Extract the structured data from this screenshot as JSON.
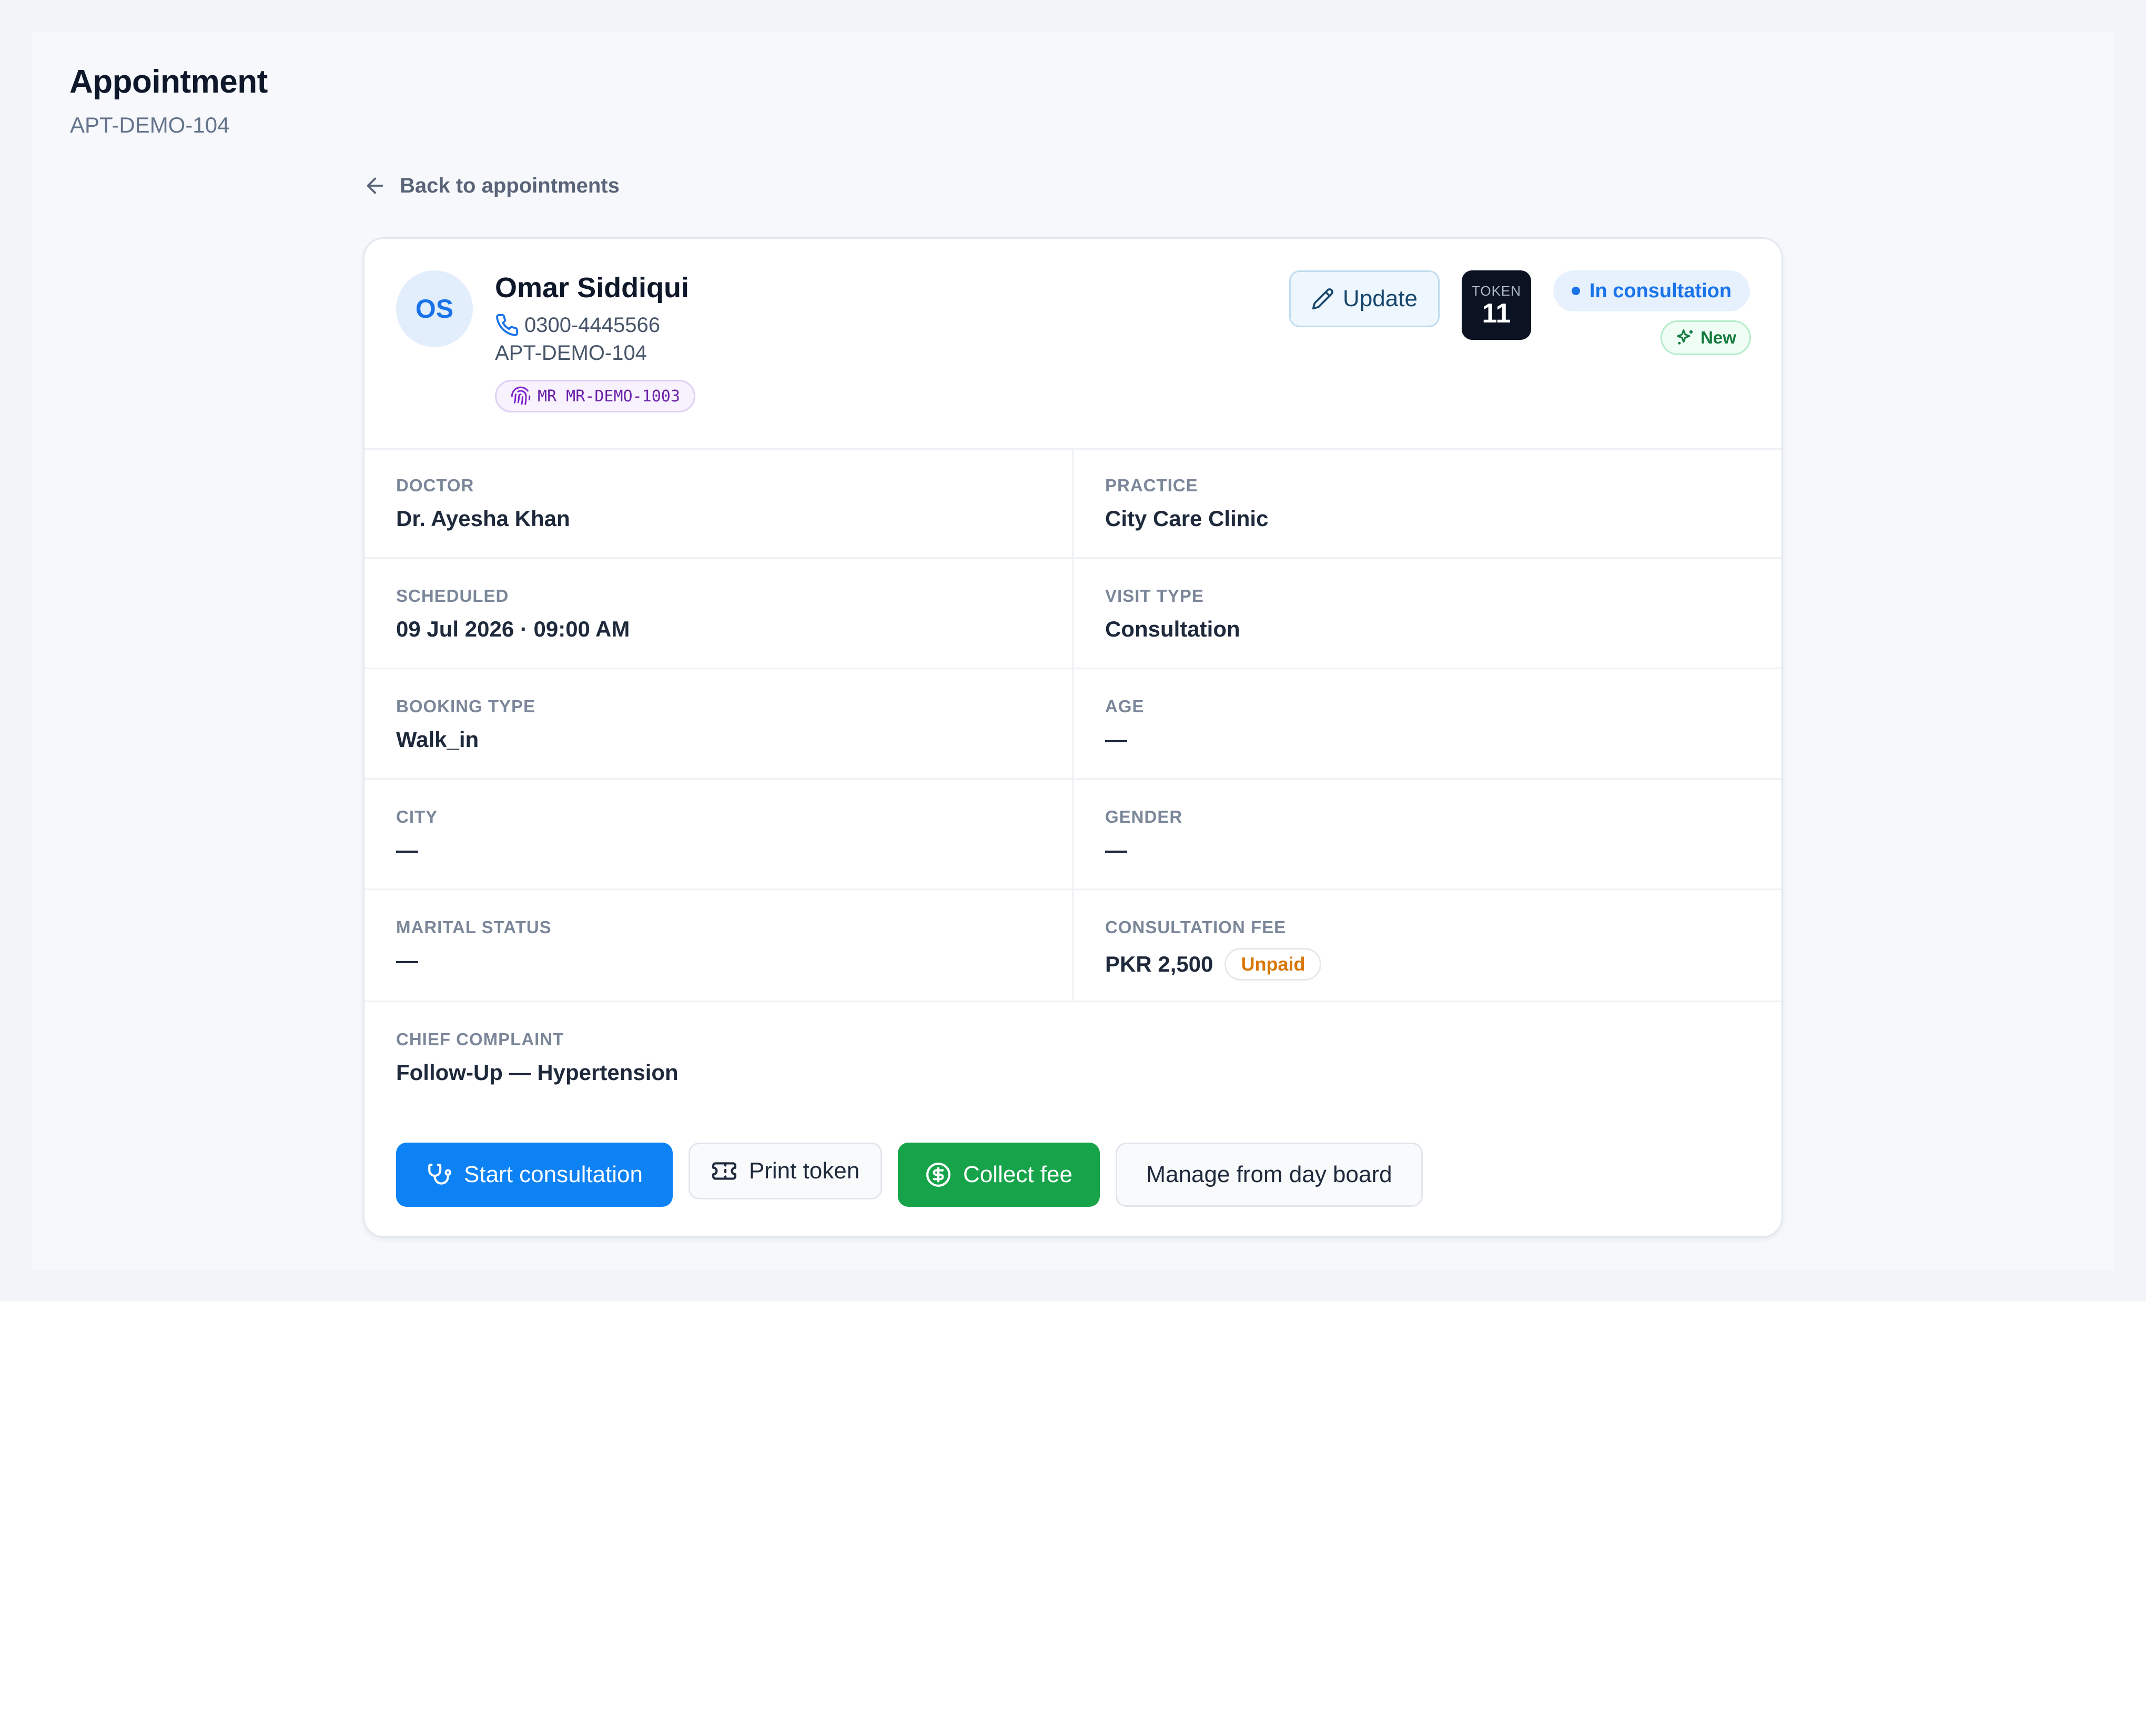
{
  "page": {
    "title": "Appointment",
    "subtitle": "APT-DEMO-104",
    "back_label": "Back to appointments"
  },
  "patient": {
    "initials": "OS",
    "name": "Omar Siddiqui",
    "phone": "0300-4445566",
    "appointment_code": "APT-DEMO-104",
    "mr_chip": "MR MR-DEMO-1003"
  },
  "header": {
    "update_label": "Update",
    "token_label": "TOKEN",
    "token_number": "11",
    "status_label": "In consultation",
    "new_label": "New"
  },
  "fields": {
    "doctor": {
      "label": "DOCTOR",
      "value": "Dr. Ayesha Khan"
    },
    "practice": {
      "label": "PRACTICE",
      "value": "City Care Clinic"
    },
    "scheduled": {
      "label": "SCHEDULED",
      "value": "09 Jul 2026 · 09:00 AM"
    },
    "visit_type": {
      "label": "VISIT TYPE",
      "value": "Consultation"
    },
    "booking_type": {
      "label": "BOOKING TYPE",
      "value": "Walk_in"
    },
    "age": {
      "label": "AGE",
      "value": "—"
    },
    "city": {
      "label": "CITY",
      "value": "—"
    },
    "gender": {
      "label": "GENDER",
      "value": "—"
    },
    "marital_status": {
      "label": "MARITAL STATUS",
      "value": "—"
    },
    "consultation_fee": {
      "label": "CONSULTATION FEE",
      "value": "PKR 2,500",
      "badge": "Unpaid"
    },
    "chief_complaint": {
      "label": "CHIEF COMPLAINT",
      "value": "Follow-Up — Hypertension"
    }
  },
  "actions": {
    "start_consultation": "Start consultation",
    "print_token": "Print token",
    "collect_fee": "Collect fee",
    "manage_day_board": "Manage from day board"
  },
  "colors": {
    "primary": "#0d82f5",
    "success": "#16a34a",
    "status_blue": "#1a73e8",
    "unpaid_orange": "#d97706",
    "mr_purple": "#6b21a8"
  },
  "icons": {
    "back": "arrow-left-icon",
    "phone": "phone-icon",
    "mr": "fingerprint-icon",
    "update": "pencil-icon",
    "new": "sparkles-icon",
    "start": "stethoscope-icon",
    "print": "ticket-icon",
    "fee": "dollar-circle-icon"
  }
}
